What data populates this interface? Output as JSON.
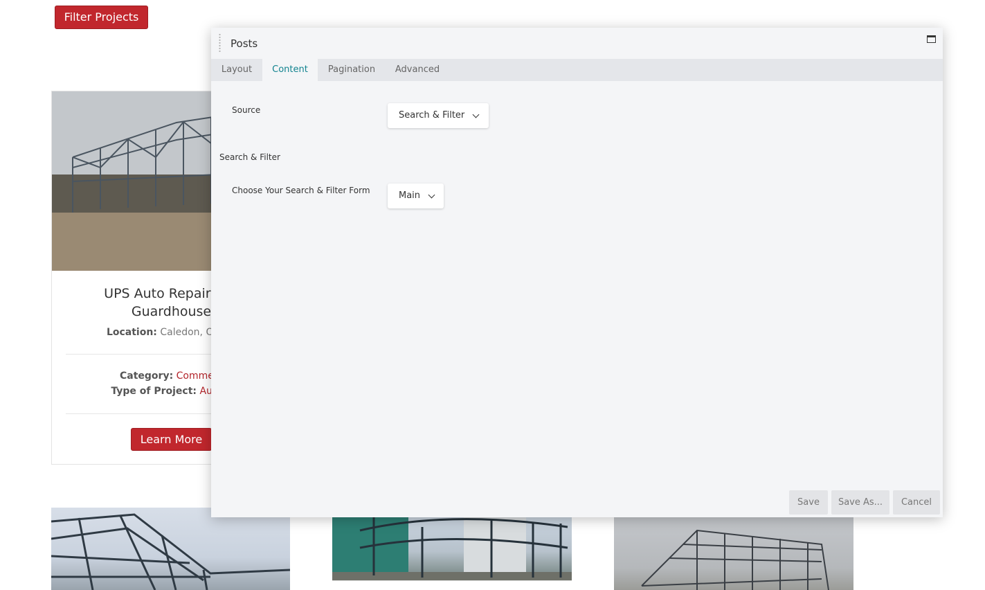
{
  "page": {
    "filter_button": "Filter Projects",
    "card": {
      "title_line1": "UPS Auto Repair Gar",
      "title_line2": "Guardhouse",
      "location_label": "Location:",
      "location_value": "Caledon, Ontari",
      "category_label": "Category:",
      "category_value": "Commerc",
      "type_label": "Type of Project:",
      "type_value": "Autom",
      "learn_more": "Learn More"
    }
  },
  "dialog": {
    "title": "Posts",
    "tabs": [
      {
        "label": "Layout",
        "active": false
      },
      {
        "label": "Content",
        "active": true
      },
      {
        "label": "Pagination",
        "active": false
      },
      {
        "label": "Advanced",
        "active": false
      }
    ],
    "source": {
      "label": "Source",
      "value": "Search & Filter"
    },
    "section_title": "Search & Filter",
    "form_select": {
      "label": "Choose Your Search & Filter Form",
      "value": "Main"
    },
    "footer": {
      "save": "Save",
      "save_as": "Save As...",
      "cancel": "Cancel"
    }
  },
  "colors": {
    "brand_red": "#c1272d",
    "tab_active": "#11838f",
    "dialog_bg": "#f4f5f7"
  },
  "icons": [
    "drag-handle-icon",
    "maximize-icon",
    "chevron-down-icon"
  ]
}
